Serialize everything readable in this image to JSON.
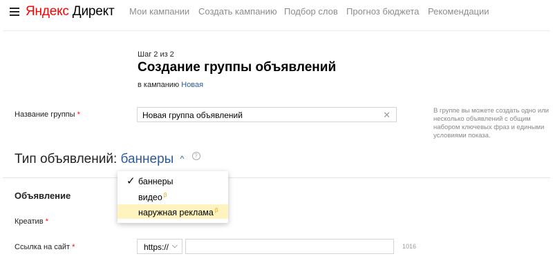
{
  "header": {
    "logo_yandex": "Яндекс",
    "logo_direct": "Директ",
    "nav": [
      "Мои кампании",
      "Создать кампанию",
      "Подбор слов",
      "Прогноз бюджета",
      "Рекомендации"
    ]
  },
  "form": {
    "step": "Шаг 2 из 2",
    "title": "Создание группы объявлений",
    "campaign_prefix": "в кампанию",
    "campaign_link": "Новая",
    "group_name_label": "Название группы",
    "required_mark": "*",
    "group_name_value": "Новая группа объявлений",
    "hint": "В группе вы можете создать одно или несколько объявлений с общим набором ключевых фраз и едиными условиями показа.",
    "ad_type_label": "Тип объявлений:",
    "ad_type_value": "баннеры",
    "help_mark": "?",
    "section_title": "Объявление",
    "creative_label": "Креатив",
    "site_link_label": "Ссылка на сайт",
    "protocol_value": "https://",
    "url_value": "",
    "url_counter": "1016"
  },
  "dropdown": {
    "items": [
      {
        "label": "баннеры",
        "checked": true,
        "beta": ""
      },
      {
        "label": "видео",
        "checked": false,
        "beta": "β"
      },
      {
        "label": "наружная реклама",
        "checked": false,
        "beta": "β"
      }
    ]
  },
  "colors": {
    "brand_red": "#ff0000",
    "link_blue": "#2c5a9c",
    "highlight": "#fff4bf",
    "beta": "#e0a500"
  }
}
